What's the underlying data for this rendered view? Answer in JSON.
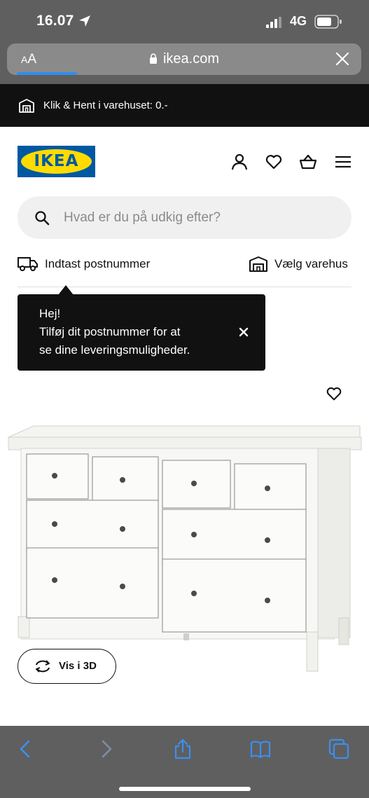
{
  "status_bar": {
    "time": "16.07",
    "network": "4G"
  },
  "browser": {
    "aa_label": "AA",
    "url": "ikea.com",
    "load_progress": 0.17
  },
  "promo": {
    "text": "Klik & Hent i varehuset: 0.-"
  },
  "header": {
    "logo_text": "IKEA"
  },
  "search": {
    "placeholder": "Hvad er du på udkig efter?"
  },
  "delivery": {
    "zip_label": "Indtast postnummer",
    "store_label": "Vælg varehus"
  },
  "tooltip": {
    "line1": "Hej!",
    "line2": "Tilføj dit postnummer for at",
    "line3": "se dine leveringsmuligheder."
  },
  "product": {
    "view3d_label": "Vis i 3D"
  },
  "colors": {
    "ikea_blue": "#0058a3",
    "ikea_yellow": "#ffdb00",
    "safari_blue": "#2f8cf0",
    "dark": "#111111",
    "chrome_gray": "#5f5f5f"
  },
  "icons": {
    "location": "location-arrow-icon",
    "signal": "signal-icon",
    "battery": "battery-icon",
    "lock": "lock-icon",
    "close": "close-icon",
    "store": "store-icon",
    "profile": "profile-icon",
    "heart": "heart-icon",
    "basket": "basket-icon",
    "menu": "menu-icon",
    "search": "search-icon",
    "truck": "truck-icon",
    "rotate_3d": "rotate-3d-icon",
    "back": "back-icon",
    "forward": "forward-icon",
    "share": "share-icon",
    "bookmarks": "bookmarks-icon",
    "tabs": "tabs-icon"
  }
}
